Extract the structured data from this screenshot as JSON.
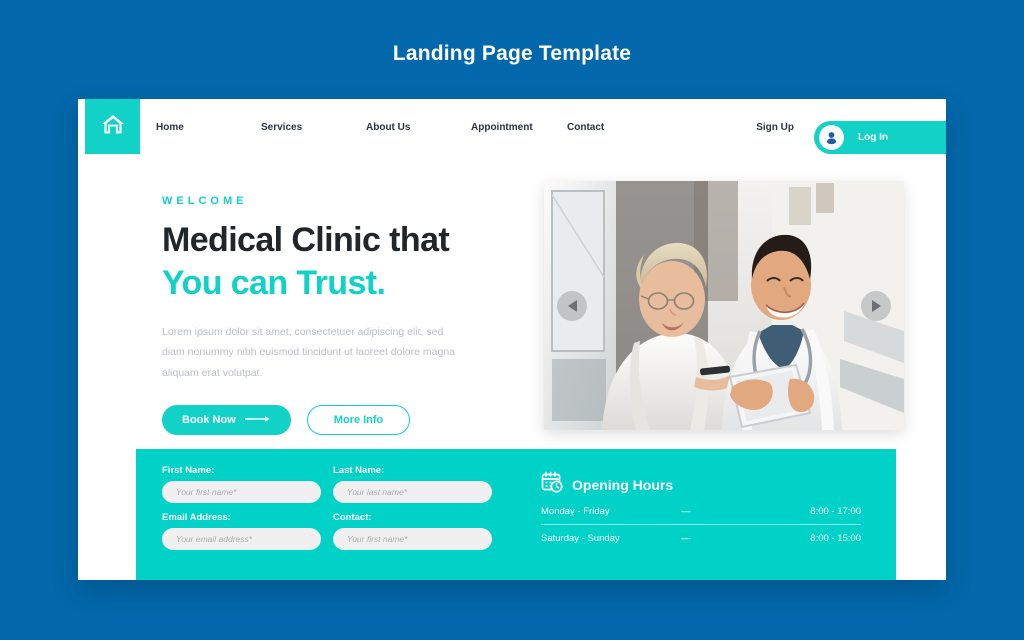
{
  "page": {
    "title": "Landing Page Template",
    "bg_color": "#0268ab",
    "accent_teal": "#12d1c6",
    "band_teal": "#00d2c8"
  },
  "nav": {
    "home_icon": "home-icon",
    "links": [
      {
        "label": "Home"
      },
      {
        "label": "Services"
      },
      {
        "label": "About Us"
      },
      {
        "label": "Appointment"
      },
      {
        "label": "Contact"
      }
    ],
    "signup_label": "Sign Up",
    "login_label": "Log In",
    "login_icon": "user-avatar-icon"
  },
  "hero": {
    "eyebrow": "WELCOME",
    "headline_line1": "Medical Clinic that",
    "headline_line2": "You can Trust.",
    "paragraph": "Lorem ipsum dolor sit amet, consectetuer adipiscing elit, sed diam nonummy nibh euismod tincidunt ut laoreet dolore magna aliquam erat volutpat.",
    "primary_button": "Book Now",
    "secondary_button": "More Info",
    "prev_icon": "arrow-left-icon",
    "next_icon": "arrow-right-icon",
    "image_alt": "doctor and elderly patient viewing a tablet in a clinic hallway"
  },
  "form": {
    "fields": [
      {
        "label": "First Name:",
        "placeholder": "Your first name*",
        "value": ""
      },
      {
        "label": "Last Name:",
        "placeholder": "Your last name*",
        "value": ""
      },
      {
        "label": "Email Address:",
        "placeholder": "Your email address*",
        "value": ""
      },
      {
        "label": "Contact:",
        "placeholder": "Your first name*",
        "value": ""
      }
    ]
  },
  "hours": {
    "icon": "calendar-clock-icon",
    "title": "Opening Hours",
    "rows": [
      {
        "day": "Monday - Friday",
        "dash": "—",
        "time": "8:00 - 17:00"
      },
      {
        "day": "Saturday - Sunday",
        "dash": "—",
        "time": "8:00 - 15:00"
      }
    ]
  }
}
